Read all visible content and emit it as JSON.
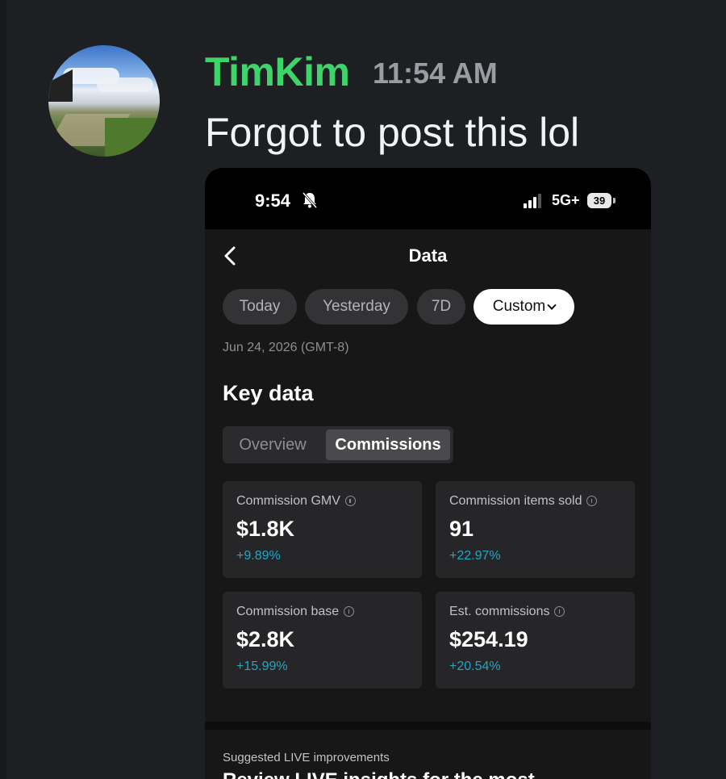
{
  "message": {
    "username": "TimKim",
    "timestamp": "11:54 AM",
    "text": "Forgot to post this lol",
    "username_color": "#3fd46a"
  },
  "phone": {
    "status_bar": {
      "time": "9:54",
      "network": "5G+",
      "battery": "39",
      "icons": [
        "bell-slash-icon",
        "signal-icon",
        "battery-icon"
      ]
    },
    "header": {
      "title": "Data",
      "back_icon": "chevron-left-icon"
    },
    "date_filters": [
      {
        "label": "Today",
        "active": false
      },
      {
        "label": "Yesterday",
        "active": false
      },
      {
        "label": "7D",
        "active": false
      },
      {
        "label": "Custom",
        "active": true
      }
    ],
    "date_range": "Jun 24, 2026 (GMT-8)",
    "key_data": {
      "title": "Key data",
      "tabs": [
        {
          "label": "Overview",
          "active": false
        },
        {
          "label": "Commissions",
          "active": true
        }
      ],
      "metrics": [
        {
          "label": "Commission GMV",
          "value": "$1.8K",
          "delta": "+9.89%"
        },
        {
          "label": "Commission items sold",
          "value": "91",
          "delta": "+22.97%"
        },
        {
          "label": "Commission base",
          "value": "$2.8K",
          "delta": "+15.99%"
        },
        {
          "label": "Est. commissions",
          "value": "$254.19",
          "delta": "+20.54%"
        }
      ],
      "delta_color": "#1fa8c7"
    },
    "suggestions": {
      "label": "Suggested LIVE improvements",
      "title": "Review LIVE insights for the most"
    }
  }
}
